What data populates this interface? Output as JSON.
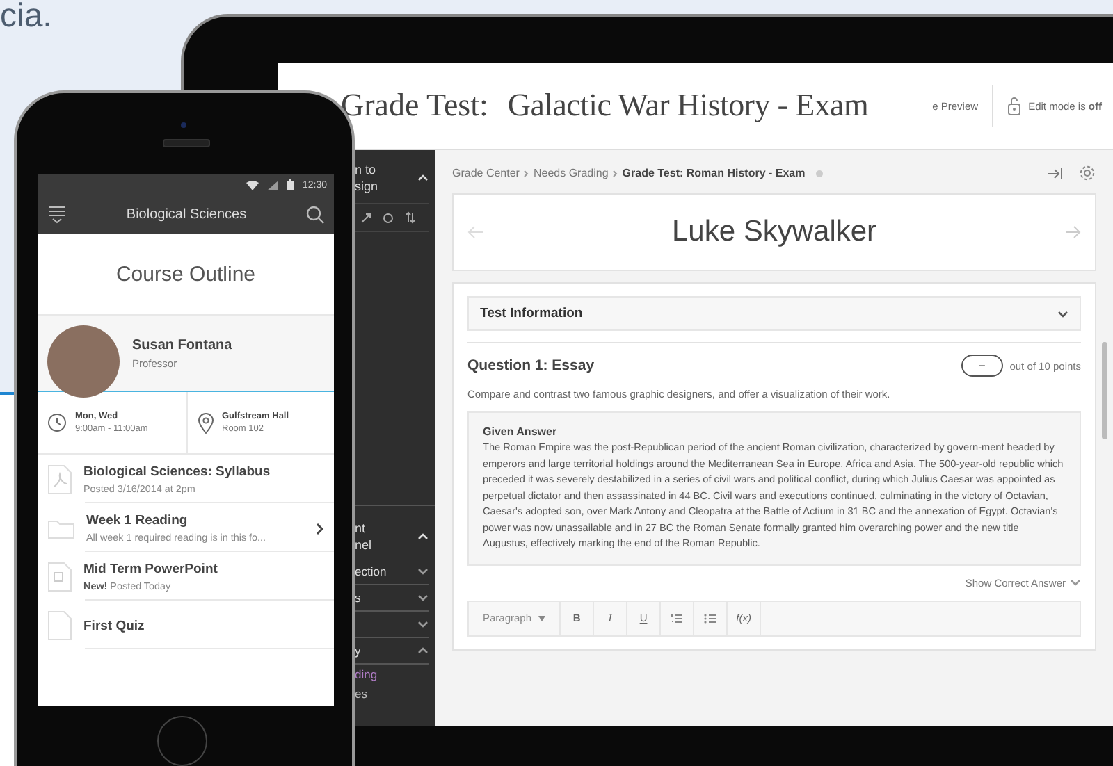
{
  "background": {
    "caption": "cia."
  },
  "tablet": {
    "header": {
      "title_prefix": "Grade Test:",
      "title": "Galactic War History - Exam",
      "preview": "e Preview",
      "edit_mode": "Edit mode is **off**"
    },
    "sidebar": {
      "top_section": {
        "lines": [
          "n to",
          "sign"
        ],
        "expanded": true
      },
      "bottom_section": {
        "lines": [
          "nt",
          "nel"
        ],
        "expanded": true,
        "items": [
          {
            "label": "ection",
            "expanded": false
          },
          {
            "label": "s",
            "expanded": false
          },
          {
            "expanded": false
          },
          {
            "label": "y",
            "expanded": true,
            "children": [
              {
                "label": "ding",
                "selected": true
              },
              {
                "label": "es",
                "selected": false
              }
            ]
          }
        ]
      }
    },
    "breadcrumb": [
      {
        "label": "Grade Center"
      },
      {
        "label": "Needs Grading"
      },
      {
        "label": "Grade Test: Roman History - Exam"
      }
    ],
    "student": "Luke Skywalker",
    "test_information": {
      "label": "Test Information",
      "expanded": false
    },
    "question": {
      "title": "Question 1: Essay",
      "score": "–",
      "points": "out of 10 points",
      "prompt": "Compare and contrast two famous graphic designers, and offer a visualization of their work."
    },
    "given_answer": {
      "heading": "Given Answer",
      "text": "The Roman Empire was the post-Republican period of the ancient Roman civilization, characterized by govern-ment headed by emperors and large territorial holdings around the Mediterranean Sea in Europe, Africa and Asia. The 500-year-old republic which preceded it was severely destabilized in a series of civil wars and political conflict, during which Julius Caesar was appointed as perpetual dictator and then assassinated in 44 BC. Civil wars and executions continued, culminating in the victory of Octavian, Caesar's adopted son, over Mark Antony and Cleopatra at the Battle of Actium in 31 BC and the annexation of Egypt. Octavian's power was now unassailable and in 27 BC the Roman Senate formally granted him overarching power and the new title Augustus, effectively marking the end of the Roman Republic."
    },
    "show_correct_answer": "Show Correct Answer",
    "editor_toolbar": {
      "format": "Paragraph",
      "buttons": [
        {
          "kind": "bold",
          "label": "B"
        },
        {
          "kind": "italic",
          "label": "I"
        },
        {
          "kind": "underline",
          "label": "U"
        },
        {
          "kind": "ordered-list"
        },
        {
          "kind": "bullet-list"
        },
        {
          "kind": "formula",
          "label": "f(x)"
        }
      ]
    }
  },
  "phone": {
    "status_bar": {
      "time": "12:30"
    },
    "header": {
      "title": "Biological Sciences"
    },
    "page_title": "Course Outline",
    "instructor": {
      "name": "Susan Fontana",
      "role": "Professor"
    },
    "schedule": [
      {
        "kind": "time",
        "title": "Mon, Wed",
        "detail": "9:00am - 11:00am"
      },
      {
        "kind": "place",
        "title": "Gulfstream Hall",
        "detail": "Room 102"
      }
    ],
    "items": [
      {
        "kind": "pdf",
        "title": "Biological Sciences: Syllabus",
        "subtitle": "Posted 3/16/2014 at 2pm"
      },
      {
        "kind": "folder",
        "title": "Week 1 Reading",
        "subtitle": "All week 1 required reading is in this fo..."
      },
      {
        "kind": "file",
        "title": "Mid Term PowerPoint",
        "subtitle": "**New!** Posted Today"
      },
      {
        "kind": "quiz",
        "title": "First Quiz"
      }
    ]
  }
}
